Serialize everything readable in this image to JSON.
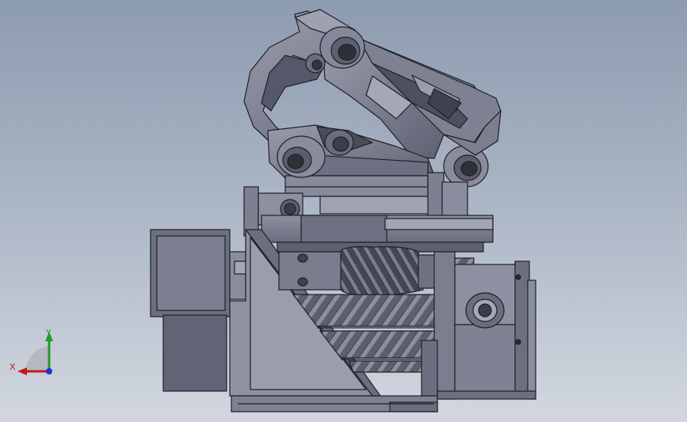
{
  "viewport": {
    "triad": {
      "x_label": "X",
      "y_label": "Y"
    },
    "colors": {
      "background_top": "#8d9bb0",
      "background_bottom": "#d2d7df",
      "part_light": "#8a8c9c",
      "part_mid": "#6f7283",
      "part_dark": "#4f5262",
      "edge": "#1f2026",
      "gear": "#5b5e6c",
      "x_axis": "#c01c1c",
      "y_axis": "#1f9a2e",
      "z_axis": "#2233cc"
    }
  },
  "model": {
    "parts": [
      "robot-arm-link-upper",
      "robot-arm-link-lower",
      "pivot-joints",
      "carriage-plate",
      "worm-gear",
      "rack-gears",
      "motor-housing",
      "support-frame",
      "bearing-mount",
      "base-plate"
    ]
  }
}
